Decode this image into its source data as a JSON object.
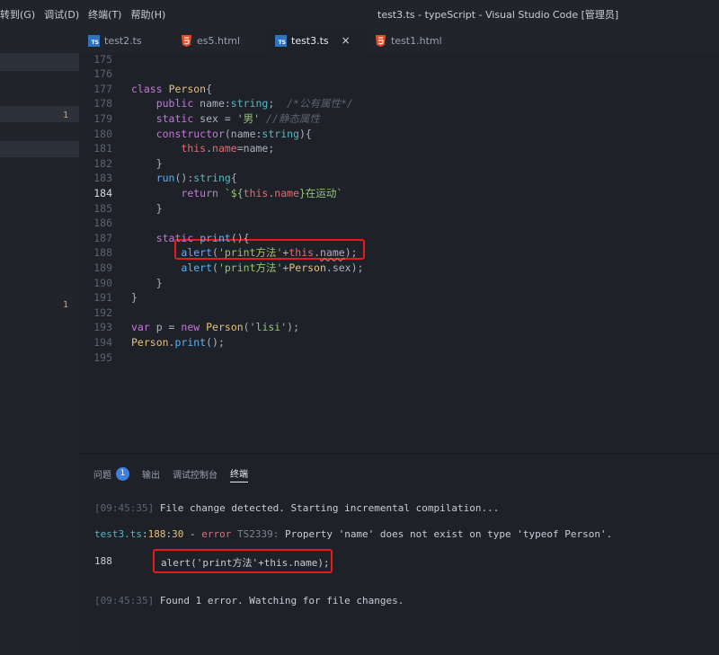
{
  "menubar": {
    "items": [
      "转到(G)",
      "调试(D)",
      "终端(T)",
      "帮助(H)"
    ],
    "title": "test3.ts - typeScript - Visual Studio Code [管理员]"
  },
  "tabs": [
    {
      "label": "test2.ts",
      "kind": "ts",
      "active": false
    },
    {
      "label": "es5.html",
      "kind": "html",
      "active": false
    },
    {
      "label": "test3.ts",
      "kind": "ts",
      "active": true
    },
    {
      "label": "test1.html",
      "kind": "html",
      "active": false
    }
  ],
  "tab_icons": {
    "ts_icon_text": "TS",
    "close_glyph": "×"
  },
  "sidebar": {
    "badges": [
      "1",
      "1"
    ]
  },
  "editor": {
    "current_line": "184",
    "lines": [
      {
        "num": "175",
        "tokens": []
      },
      {
        "num": "176",
        "tokens": []
      },
      {
        "num": "177",
        "tokens": [
          [
            "kw",
            "class"
          ],
          [
            "plain",
            " "
          ],
          [
            "cls",
            "Person"
          ],
          [
            "plain",
            "{"
          ]
        ]
      },
      {
        "num": "178",
        "tokens": [
          [
            "plain",
            "    "
          ],
          [
            "kw",
            "public"
          ],
          [
            "plain",
            " name:"
          ],
          [
            "ty",
            "string"
          ],
          [
            "plain",
            ";  "
          ],
          [
            "cm",
            "/*公有属性*/"
          ]
        ]
      },
      {
        "num": "179",
        "tokens": [
          [
            "plain",
            "    "
          ],
          [
            "kw",
            "static"
          ],
          [
            "plain",
            " sex = "
          ],
          [
            "str",
            "'男'"
          ],
          [
            "plain",
            " "
          ],
          [
            "cm",
            "//静态属性"
          ]
        ]
      },
      {
        "num": "180",
        "tokens": [
          [
            "plain",
            "    "
          ],
          [
            "kw",
            "constructor"
          ],
          [
            "plain",
            "(name:"
          ],
          [
            "ty",
            "string"
          ],
          [
            "plain",
            "){"
          ]
        ]
      },
      {
        "num": "181",
        "tokens": [
          [
            "plain",
            "        "
          ],
          [
            "th",
            "this"
          ],
          [
            "plain",
            "."
          ],
          [
            "th",
            "name"
          ],
          [
            "plain",
            "=name;"
          ]
        ]
      },
      {
        "num": "182",
        "tokens": [
          [
            "plain",
            "    }"
          ]
        ]
      },
      {
        "num": "183",
        "tokens": [
          [
            "plain",
            "    "
          ],
          [
            "fn",
            "run"
          ],
          [
            "plain",
            "():"
          ],
          [
            "ty",
            "string"
          ],
          [
            "plain",
            "{"
          ]
        ]
      },
      {
        "num": "184",
        "tokens": [
          [
            "plain",
            "        "
          ],
          [
            "kw",
            "return"
          ],
          [
            "plain",
            " "
          ],
          [
            "str",
            "`${"
          ],
          [
            "th",
            "this"
          ],
          [
            "plain",
            "."
          ],
          [
            "th",
            "name"
          ],
          [
            "str",
            "}在运动`"
          ]
        ]
      },
      {
        "num": "185",
        "tokens": [
          [
            "plain",
            "    }"
          ]
        ]
      },
      {
        "num": "186",
        "tokens": []
      },
      {
        "num": "187",
        "tokens": [
          [
            "plain",
            "    "
          ],
          [
            "kw",
            "static"
          ],
          [
            "plain",
            " "
          ],
          [
            "fn",
            "print"
          ],
          [
            "plain",
            "(){"
          ]
        ]
      },
      {
        "num": "188",
        "tokens": [
          [
            "plain",
            "        "
          ],
          [
            "fn",
            "alert"
          ],
          [
            "plain",
            "("
          ],
          [
            "str",
            "'print方法'"
          ],
          [
            "plain",
            "+"
          ],
          [
            "th",
            "this"
          ],
          [
            "plain",
            "."
          ],
          [
            "squig",
            "name"
          ],
          [
            "plain",
            ");"
          ]
        ]
      },
      {
        "num": "189",
        "tokens": [
          [
            "plain",
            "        "
          ],
          [
            "fn",
            "alert"
          ],
          [
            "plain",
            "("
          ],
          [
            "str",
            "'print方法'"
          ],
          [
            "plain",
            "+"
          ],
          [
            "cls",
            "Person"
          ],
          [
            "plain",
            ".sex);"
          ]
        ]
      },
      {
        "num": "190",
        "tokens": [
          [
            "plain",
            "    }"
          ]
        ]
      },
      {
        "num": "191",
        "tokens": [
          [
            "plain",
            "}"
          ]
        ]
      },
      {
        "num": "192",
        "tokens": []
      },
      {
        "num": "193",
        "tokens": [
          [
            "kw",
            "var"
          ],
          [
            "plain",
            " p = "
          ],
          [
            "kw",
            "new"
          ],
          [
            "plain",
            " "
          ],
          [
            "cls",
            "Person"
          ],
          [
            "plain",
            "("
          ],
          [
            "str",
            "'lisi'"
          ],
          [
            "plain",
            ");"
          ]
        ]
      },
      {
        "num": "194",
        "tokens": [
          [
            "cls",
            "Person"
          ],
          [
            "plain",
            "."
          ],
          [
            "fn",
            "print"
          ],
          [
            "plain",
            "();"
          ]
        ]
      },
      {
        "num": "195",
        "tokens": []
      }
    ]
  },
  "panel": {
    "tabs": [
      "问题",
      "输出",
      "调试控制台",
      "终端"
    ],
    "problems_count": "1",
    "active_tab": "终端",
    "terminal": {
      "line1_time": "09:45:35",
      "line1_text": " File change detected. Starting incremental compilation...",
      "err_file": "test3.ts",
      "err_line": "188",
      "err_col": "30",
      "err_word": "error",
      "err_code": "TS2339:",
      "err_msg": " Property 'name' does not exist on type 'typeof Person'.",
      "snippet_num": "188",
      "snippet_code": "alert('print方法'+this.name);",
      "line4_time": "09:45:35",
      "line4_text": " Found 1 error. Watching for file changes."
    }
  }
}
